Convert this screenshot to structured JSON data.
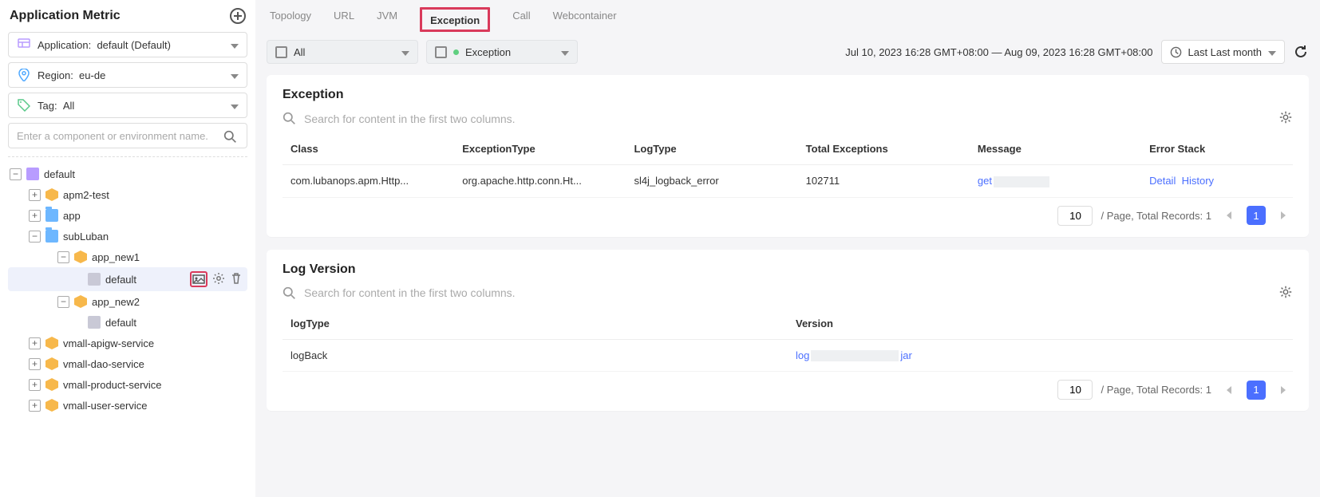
{
  "sidebar": {
    "title": "Application Metric",
    "application_selector": {
      "label": "Application:",
      "value": "default (Default)"
    },
    "region_selector": {
      "label": "Region:",
      "value": "eu-de"
    },
    "tag_selector": {
      "label": "Tag:",
      "value": "All"
    },
    "search_placeholder": "Enter a component or environment name.",
    "tree": {
      "root": {
        "label": "default"
      },
      "n1": {
        "label": "apm2-test"
      },
      "n2": {
        "label": "app"
      },
      "n3": {
        "label": "subLuban"
      },
      "n3a": {
        "label": "app_new1"
      },
      "n3a1": {
        "label": "default"
      },
      "n3b": {
        "label": "app_new2"
      },
      "n3b1": {
        "label": "default"
      },
      "n4": {
        "label": "vmall-apigw-service"
      },
      "n5": {
        "label": "vmall-dao-service"
      },
      "n6": {
        "label": "vmall-product-service"
      },
      "n7": {
        "label": "vmall-user-service"
      }
    }
  },
  "tabs": {
    "topology": "Topology",
    "url": "URL",
    "jvm": "JVM",
    "exception": "Exception",
    "call": "Call",
    "webcontainer": "Webcontainer"
  },
  "toolbar": {
    "tier_picker": "All",
    "type_picker": "Exception",
    "time_range": "Jul 10, 2023 16:28 GMT+08:00 — Aug 09, 2023 16:28 GMT+08:00",
    "period_label": "Last Last month"
  },
  "panels": {
    "exception": {
      "title": "Exception",
      "search_placeholder": "Search for content in the first two columns.",
      "headers": {
        "class": "Class",
        "exceptionType": "ExceptionType",
        "logType": "LogType",
        "totalExceptions": "Total Exceptions",
        "message": "Message",
        "errorStack": "Error Stack"
      },
      "rows": [
        {
          "class": "com.lubanops.apm.Http...",
          "exceptionType": "org.apache.http.conn.Ht...",
          "logType": "sl4j_logback_error",
          "totalExceptions": "102711",
          "messagePrefix": "get",
          "detailLabel": "Detail",
          "historyLabel": "History"
        }
      ],
      "pager": {
        "size": "10",
        "text": "/ Page,  Total Records: 1",
        "page": "1"
      }
    },
    "logversion": {
      "title": "Log Version",
      "search_placeholder": "Search for content in the first two columns.",
      "headers": {
        "logType": "logType",
        "version": "Version"
      },
      "rows": [
        {
          "logType": "logBack",
          "versionPrefix": "log",
          "versionSuffix": "jar"
        }
      ],
      "pager": {
        "size": "10",
        "text": "/ Page,  Total Records: 1",
        "page": "1"
      }
    }
  }
}
